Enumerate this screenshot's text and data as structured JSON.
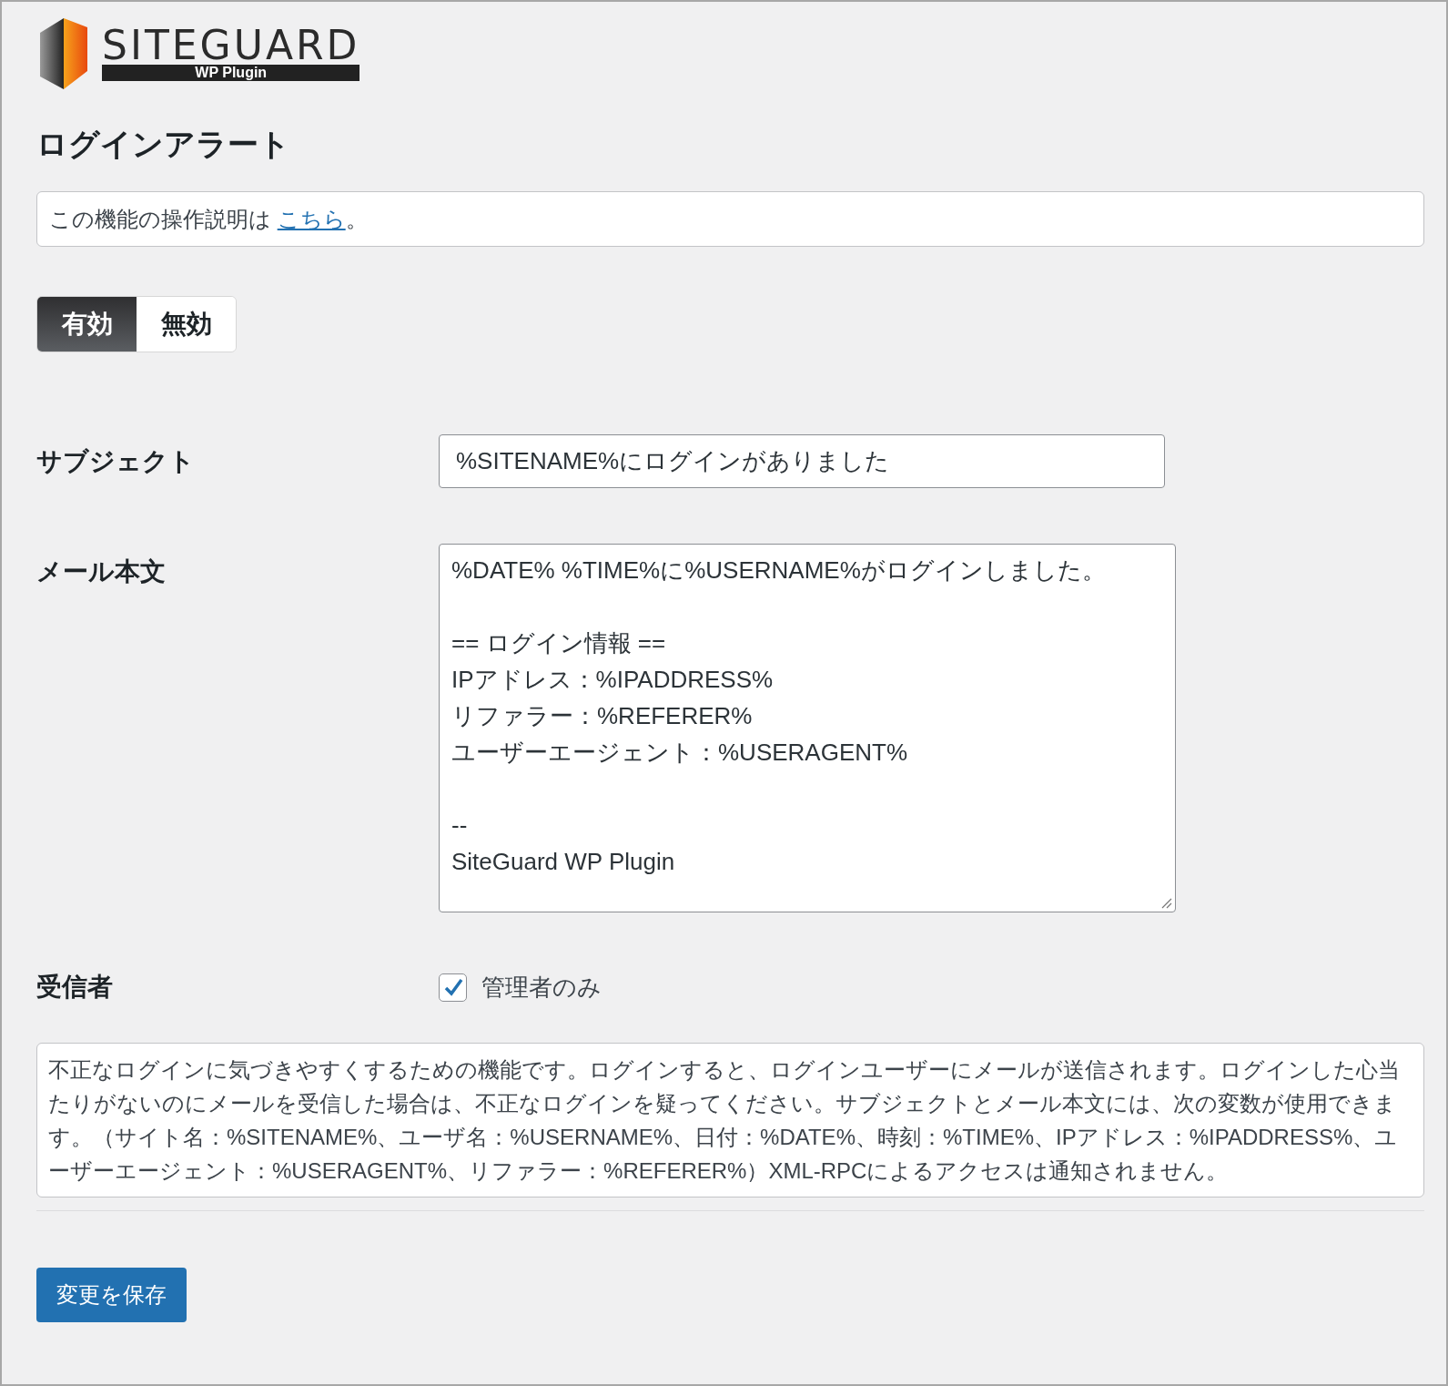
{
  "logo": {
    "name": "SITEGUARD",
    "tagline": "WP Plugin"
  },
  "title": "ログインアラート",
  "notice": {
    "before": "この機能の操作説明は ",
    "link": "こちら",
    "after": "。"
  },
  "toggle": [
    {
      "label": "有効",
      "selected": true
    },
    {
      "label": "無効",
      "selected": false
    }
  ],
  "fields": [
    {
      "kind": "text",
      "label": "サブジェクト",
      "value": "%SITENAME%にログインがありました"
    },
    {
      "kind": "textarea",
      "label": "メール本文",
      "value": "%DATE% %TIME%に%USERNAME%がログインしました。\n\n== ログイン情報 ==\nIPアドレス：%IPADDRESS%\nリファラー：%REFERER%\nユーザーエージェント：%USERAGENT%\n\n--\nSiteGuard WP Plugin"
    },
    {
      "kind": "checkbox",
      "label": "受信者",
      "option": "管理者のみ",
      "checked": true
    }
  ],
  "description": "不正なログインに気づきやすくするための機能です。ログインすると、ログインユーザーにメールが送信されます。ログインした心当たりがないのにメールを受信した場合は、不正なログインを疑ってください。サブジェクトとメール本文には、次の変数が使用できます。（サイト名：%SITENAME%、ユーザ名：%USERNAME%、日付：%DATE%、時刻：%TIME%、IPアドレス：%IPADDRESS%、ユーザーエージェント：%USERAGENT%、リファラー：%REFERER%）XML-RPCによるアクセスは通知されません。",
  "save_button": "変更を保存"
}
